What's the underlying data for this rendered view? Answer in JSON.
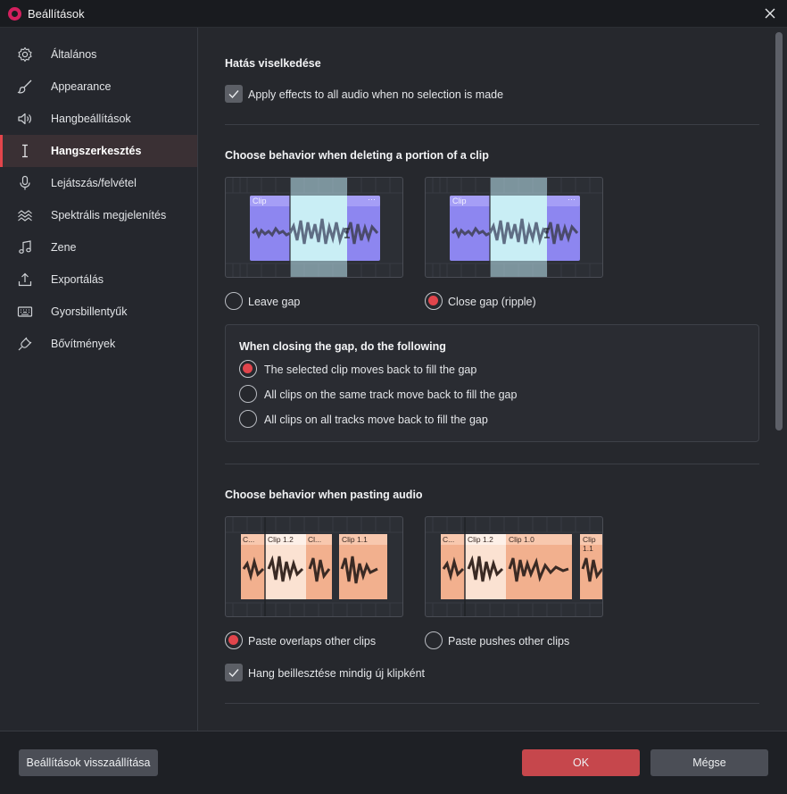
{
  "window": {
    "title": "Beállítások"
  },
  "sidebar": {
    "items": [
      {
        "label": "Általános",
        "icon": "gear-icon"
      },
      {
        "label": "Appearance",
        "icon": "brush-icon"
      },
      {
        "label": "Hangbeállítások",
        "icon": "speaker-icon"
      },
      {
        "label": "Hangszerkesztés",
        "icon": "text-cursor-icon",
        "active": true
      },
      {
        "label": "Lejátszás/felvétel",
        "icon": "microphone-icon"
      },
      {
        "label": "Spektrális megjelenítés",
        "icon": "spectral-icon"
      },
      {
        "label": "Zene",
        "icon": "music-note-icon"
      },
      {
        "label": "Exportálás",
        "icon": "export-icon"
      },
      {
        "label": "Gyorsbillentyűk",
        "icon": "keyboard-icon"
      },
      {
        "label": "Bővítmények",
        "icon": "plug-icon"
      }
    ]
  },
  "main": {
    "effects": {
      "title": "Hatás viselkedése",
      "apply_all_label": "Apply effects to all audio when no selection is made",
      "apply_all_checked": true
    },
    "delete": {
      "title": "Choose behavior when deleting a portion of a clip",
      "clip_label": "Clip",
      "menu_dots": "···",
      "leave_gap_label": "Leave gap",
      "close_gap_label": "Close gap (ripple)",
      "selected": "close_gap"
    },
    "closing_gap": {
      "title": "When closing the gap, do the following",
      "options": [
        {
          "label": "The selected clip moves back to fill the gap",
          "selected": true
        },
        {
          "label": "All clips on the same track move back to fill the gap",
          "selected": false
        },
        {
          "label": "All clips on all tracks move back to fill the gap",
          "selected": false
        }
      ]
    },
    "paste": {
      "title": "Choose behavior when pasting audio",
      "overlap_clips": [
        "C...",
        "Clip 1.2",
        "Cl...",
        "Clip 1.1"
      ],
      "push_clips": [
        "C...",
        "Clip 1.2",
        "Clip 1.0",
        "Clip 1.1"
      ],
      "overlap_label": "Paste overlaps other clips",
      "push_label": "Paste pushes other clips",
      "selected": "overlap",
      "new_clip_label": "Hang beillesztése mindig új klipként",
      "new_clip_checked": true
    }
  },
  "footer": {
    "reset_label": "Beállítások visszaállítása",
    "ok_label": "OK",
    "cancel_label": "Mégse"
  },
  "colors": {
    "accent": "#e1454c",
    "clip_purple": "#8d86f0",
    "clip_peach": "#f2b08e",
    "selection": "#bfe8f2"
  }
}
